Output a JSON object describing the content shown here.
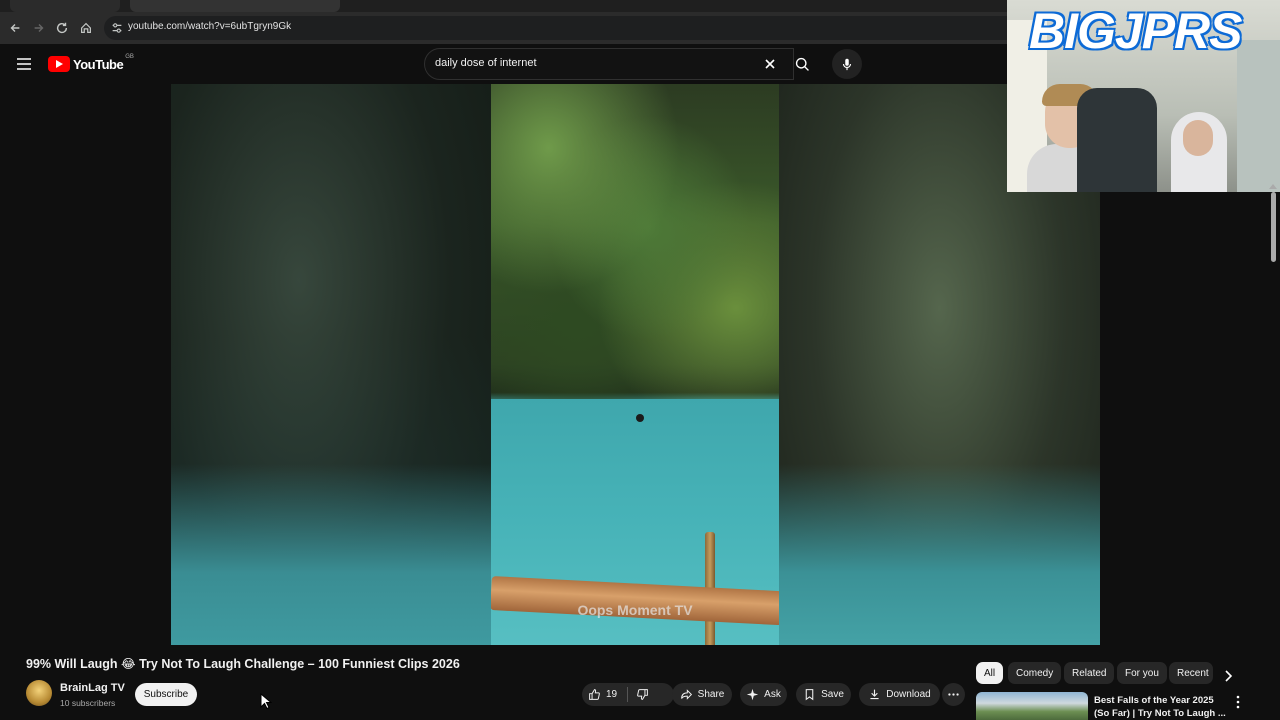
{
  "browser": {
    "url": "youtube.com/watch?v=6ubTgryn9Gk"
  },
  "header": {
    "logo_text": "YouTube",
    "region_code": "GB",
    "search_query": "daily dose of internet"
  },
  "player": {
    "watermark": "Oops Moment TV"
  },
  "stream_overlay": {
    "logo_text": "BIGJPRS"
  },
  "video": {
    "title": "99% Will Laugh 😂 Try Not To Laugh Challenge – 100 Funniest Clips 2026",
    "channel_name": "BrainLag TV",
    "subscribers": "10 subscribers",
    "subscribe_label": "Subscribe",
    "like_count": "19",
    "share_label": "Share",
    "ask_label": "Ask",
    "save_label": "Save",
    "download_label": "Download"
  },
  "chips": [
    "All",
    "Comedy",
    "Related",
    "For you",
    "Recent"
  ],
  "recommendation": {
    "title": "Best Falls of the Year 2025 (So Far) | Try Not To Laugh ..."
  }
}
